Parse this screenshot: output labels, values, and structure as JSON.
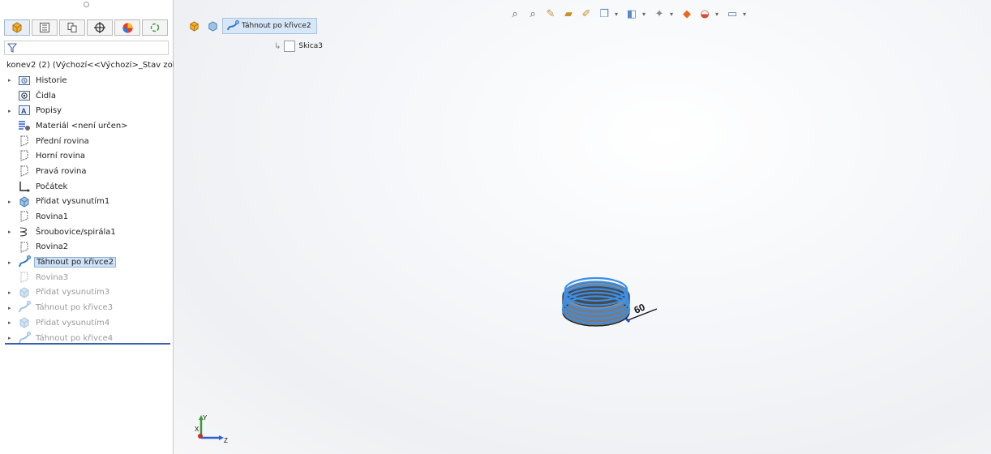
{
  "tree": {
    "root_label": "konev2 (2)  (Výchozí<<Výchozí>_Stav zob",
    "items": [
      {
        "label": "Historie",
        "icon": "history-folder-icon",
        "expandable": true,
        "state": "normal"
      },
      {
        "label": "Čidla",
        "icon": "sensors-icon",
        "expandable": false,
        "state": "normal"
      },
      {
        "label": "Popisy",
        "icon": "annotations-icon",
        "expandable": true,
        "state": "normal"
      },
      {
        "label": "Materiál <není určen>",
        "icon": "material-icon",
        "expandable": false,
        "state": "normal"
      },
      {
        "label": "Přední rovina",
        "icon": "plane-icon",
        "expandable": false,
        "state": "normal"
      },
      {
        "label": "Horní rovina",
        "icon": "plane-icon",
        "expandable": false,
        "state": "normal"
      },
      {
        "label": "Pravá rovina",
        "icon": "plane-icon",
        "expandable": false,
        "state": "normal"
      },
      {
        "label": "Počátek",
        "icon": "origin-icon",
        "expandable": false,
        "state": "normal"
      },
      {
        "label": "Přidat vysunutím1",
        "icon": "extrude-icon",
        "expandable": true,
        "state": "normal"
      },
      {
        "label": "Rovina1",
        "icon": "plane-icon",
        "expandable": false,
        "state": "normal"
      },
      {
        "label": "Šroubovice/spirála1",
        "icon": "helix-icon",
        "expandable": true,
        "state": "normal"
      },
      {
        "label": "Rovina2",
        "icon": "plane-icon",
        "expandable": false,
        "state": "normal"
      },
      {
        "label": "Táhnout po křivce2",
        "icon": "sweep-icon",
        "expandable": true,
        "state": "selected"
      },
      {
        "label": "Rovina3",
        "icon": "plane-icon",
        "expandable": false,
        "state": "suppressed"
      },
      {
        "label": "Přidat vysunutím3",
        "icon": "extrude-icon",
        "expandable": true,
        "state": "suppressed"
      },
      {
        "label": "Táhnout po křivce3",
        "icon": "sweep-icon",
        "expandable": true,
        "state": "suppressed"
      },
      {
        "label": "Přidat vysunutím4",
        "icon": "extrude-icon",
        "expandable": true,
        "state": "suppressed"
      },
      {
        "label": "Táhnout po křivce4",
        "icon": "sweep-icon",
        "expandable": true,
        "state": "suppressed"
      }
    ]
  },
  "breadcrumb": {
    "feature_label": "Táhnout po křivce2",
    "sketch_label": "Skica3"
  },
  "model": {
    "dimension_label": "60"
  },
  "triad": {
    "y_label": "Y",
    "x_label": "X",
    "z_label": "Z"
  },
  "colors": {
    "selection": "#cfe2f7",
    "tree_end_line": "#3b5fa8",
    "helix": "#3a8ee6"
  }
}
